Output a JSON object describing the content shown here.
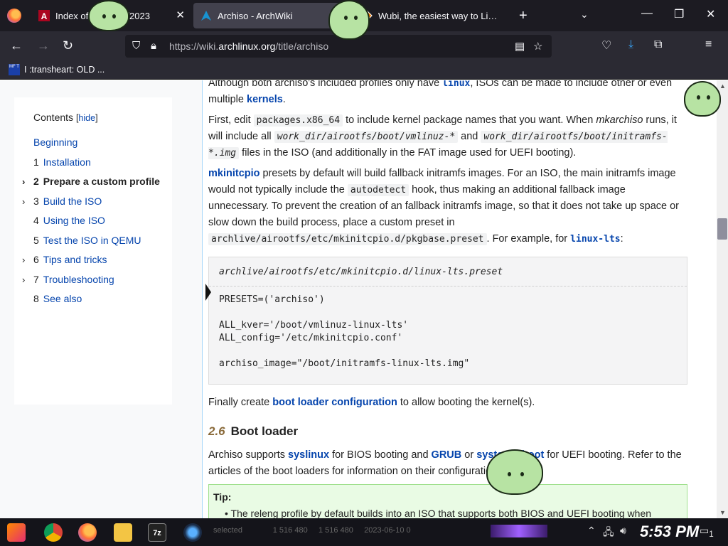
{
  "tabs": [
    {
      "title": "Index of /linux/iso/2023",
      "favicon": "university-logo"
    },
    {
      "title": "Archiso - ArchWiki",
      "favicon": "arch-logo",
      "active": true
    },
    {
      "title": "Wubi, the easiest way to Linux",
      "favicon": "wubi-logo"
    }
  ],
  "url": {
    "prefix": "https://wiki.",
    "domain": "archlinux.org",
    "path": "/title/archiso"
  },
  "bookmarks": [
    {
      "label": "I :transheart: OLD ...",
      "icon": "MF T"
    }
  ],
  "toc": {
    "title": "Contents",
    "hide_bracket_open": "[",
    "hide": "hide",
    "hide_bracket_close": "]",
    "items": [
      {
        "num": "",
        "label": "Beginning",
        "expandable": false
      },
      {
        "num": "1",
        "label": "Installation",
        "expandable": false
      },
      {
        "num": "2",
        "label": "Prepare a custom profile",
        "expandable": true,
        "current": true
      },
      {
        "num": "3",
        "label": "Build the ISO",
        "expandable": true
      },
      {
        "num": "4",
        "label": "Using the ISO",
        "expandable": false
      },
      {
        "num": "5",
        "label": "Test the ISO in QEMU",
        "expandable": false
      },
      {
        "num": "6",
        "label": "Tips and tricks",
        "expandable": true
      },
      {
        "num": "7",
        "label": "Troubleshooting",
        "expandable": true
      },
      {
        "num": "8",
        "label": "See also",
        "expandable": false
      }
    ]
  },
  "article": {
    "p1": {
      "a": "Although both archiso's included profiles only have ",
      "link1": "linux",
      "b": ", ISOs can be made to include other or even multiple ",
      "link2": "kernels",
      "c": "."
    },
    "p2": {
      "a": "First, edit ",
      "code1": "packages.x86_64",
      "b": " to include kernel package names that you want. When ",
      "em": "mkarchiso",
      "c": " runs, it will include all ",
      "code2": "work_dir/airootfs/boot/vmlinuz-*",
      "d": " and ",
      "code3": "work_dir/airootfs/boot/initramfs-*.img",
      "e": " files in the ISO (and additionally in the FAT image used for UEFI booting)."
    },
    "p3": {
      "link1": "mkinitcpio",
      "a": " presets by default will build fallback initramfs images. For an ISO, the main initramfs image would not typically include the ",
      "code1": "autodetect",
      "b": " hook, thus making an additional fallback image unnecessary. To prevent the creation of an fallback initramfs image, so that it does not take up space or slow down the build process, place a custom preset in ",
      "code2": "archlive/airootfs/etc/mkinitcpio.d/pkgbase.preset",
      "c": ". For example, for ",
      "link2": "linux-lts",
      "d": ":"
    },
    "code_block": {
      "header": "archlive/airootfs/etc/mkinitcpio.d/linux-lts.preset",
      "body": "PRESETS=('archiso')\n\nALL_kver='/boot/vmlinuz-linux-lts'\nALL_config='/etc/mkinitcpio.conf'\n\narchiso_image=\"/boot/initramfs-linux-lts.img\""
    },
    "p4": {
      "a": "Finally create ",
      "link1": "boot loader configuration",
      "b": " to allow booting the kernel(s)."
    },
    "h2": {
      "num": "2.6",
      "title": "Boot loader"
    },
    "p5": {
      "a": "Archiso supports ",
      "link1": "syslinux",
      "b": " for BIOS booting and ",
      "link2": "GRUB",
      "c": " or ",
      "link3": "systemd-boot",
      "d": " for UEFI booting. Refer to the articles of the boot loaders for information on their configuration."
    },
    "tip": {
      "title": "Tip:",
      "text": "The releng profile by default builds into an ISO that supports both BIOS and UEFI booting when"
    }
  },
  "taskbar": {
    "behind_text": "selected              1 516 480     1 516 480     2023-06-10 0",
    "clock": "5:53 PM",
    "notifications": "1"
  },
  "colors": {
    "link": "#0645ad",
    "tabbar": "#1c1b22",
    "toolbar": "#2b2a33",
    "tip_bg": "#e9fbe4"
  }
}
